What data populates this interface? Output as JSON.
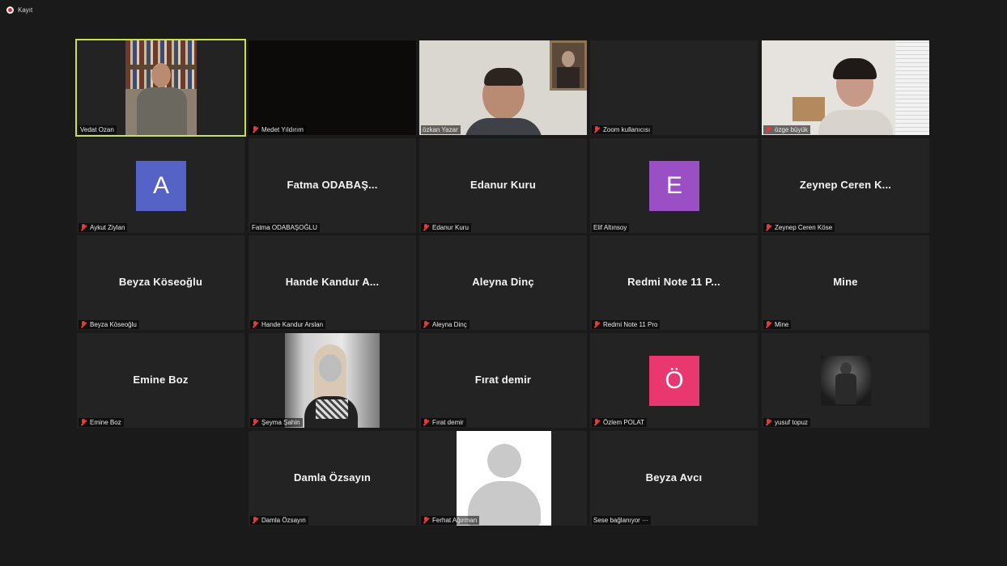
{
  "recording": {
    "label": "Kayıt"
  },
  "active_speaker": "Vedat Ozan",
  "colors": {
    "active_border": "#c9df5a",
    "muted_icon": "#e23b3b",
    "avatar_A": "#5663c6",
    "avatar_E": "#9b4fc5",
    "avatar_O": "#e8386f"
  },
  "participants": [
    {
      "id": "vedat",
      "label": "Vedat Ozan",
      "muted": false,
      "type": "video"
    },
    {
      "id": "medet",
      "label": "Medet Yıldırım",
      "muted": true,
      "type": "video-dark"
    },
    {
      "id": "ozkan",
      "label": "özkan Yazar",
      "muted": false,
      "type": "video"
    },
    {
      "id": "zoomuser",
      "label": "Zoom kullanıcısı",
      "muted": true,
      "type": "blank"
    },
    {
      "id": "ozge",
      "label": "özge büyük",
      "muted": true,
      "type": "video"
    },
    {
      "id": "aykut",
      "label": "Aykut Ziylan",
      "muted": true,
      "type": "avatar",
      "letter": "A"
    },
    {
      "id": "fatma",
      "label": "Fatma ODABAŞOĞLU",
      "display": "Fatma  ODABAŞ...",
      "muted": false,
      "type": "name"
    },
    {
      "id": "edanur",
      "label": "Edanur Kuru",
      "display": "Edanur Kuru",
      "muted": true,
      "type": "name"
    },
    {
      "id": "elif",
      "label": "Elif Altınsoy",
      "muted": false,
      "type": "avatar",
      "letter": "E"
    },
    {
      "id": "zeynep",
      "label": "Zeynep Ceren Köse",
      "display": "Zeynep  Ceren  K...",
      "muted": true,
      "type": "name"
    },
    {
      "id": "beyzak",
      "label": "Beyza Köseoğlu",
      "display": "Beyza Köseoğlu",
      "muted": true,
      "type": "name"
    },
    {
      "id": "hande",
      "label": "Hande Kandur Arslan",
      "display": "Hande  Kandur  A...",
      "muted": true,
      "type": "name"
    },
    {
      "id": "aleyna",
      "label": "Aleyna Dinç",
      "display": "Aleyna Dinç",
      "muted": true,
      "type": "name"
    },
    {
      "id": "redmi",
      "label": "Redmi Note 11 Pro",
      "display": "Redmi  Note  11  P...",
      "muted": true,
      "type": "name"
    },
    {
      "id": "mine",
      "label": "Mine",
      "display": "Mine",
      "muted": true,
      "type": "name"
    },
    {
      "id": "emine",
      "label": "Emine Boz",
      "display": "Emine Boz",
      "muted": true,
      "type": "name"
    },
    {
      "id": "seyma",
      "label": "Şeyma Şahin",
      "muted": true,
      "type": "photo"
    },
    {
      "id": "firat",
      "label": "Fırat demir",
      "display": "Fırat demir",
      "muted": true,
      "type": "name"
    },
    {
      "id": "ozlem",
      "label": "Özlem POLAT",
      "muted": true,
      "type": "avatar",
      "letter": "Ö"
    },
    {
      "id": "yusuf",
      "label": "yusuf topuz",
      "muted": true,
      "type": "photo-small"
    },
    {
      "id": "damla",
      "label": "Damla Özsayın",
      "display": "Damla Özsayın",
      "muted": true,
      "type": "name"
    },
    {
      "id": "ferhat",
      "label": "Ferhat Ağırman",
      "muted": true,
      "type": "default-avatar"
    },
    {
      "id": "beyzaa",
      "label": "Sese bağlanıyor ···",
      "display": "Beyza Avcı",
      "muted": false,
      "type": "name"
    }
  ]
}
